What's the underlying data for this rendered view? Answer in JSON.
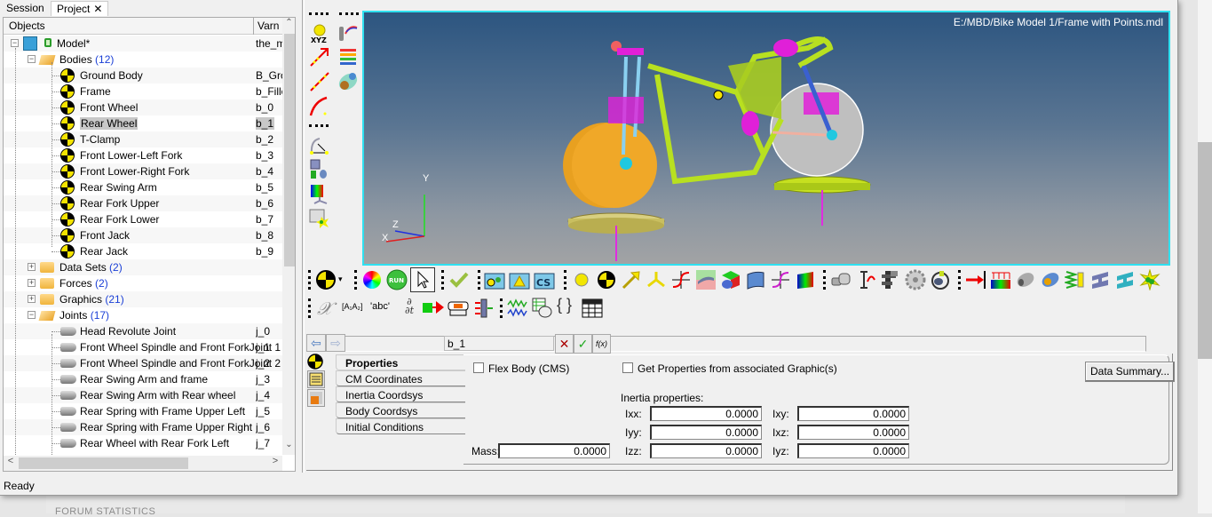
{
  "left_panel": {
    "tabs": [
      {
        "label": "Session"
      },
      {
        "label": "Project",
        "close": "✕",
        "active": true
      }
    ],
    "columns": {
      "objects": "Objects",
      "varname": "Varn"
    },
    "tree": [
      {
        "label": "Model*",
        "var": "the_m",
        "icon": "model-icon",
        "level": 0,
        "expanded": true
      },
      {
        "label": "Bodies",
        "count": "(12)",
        "icon": "folder-open-icon",
        "level": 1,
        "expanded": true
      },
      {
        "label": "Ground Body",
        "var": "B_Gro",
        "icon": "body-icon",
        "level": 2
      },
      {
        "label": "Frame",
        "var": "b_Fille",
        "icon": "body-icon",
        "level": 2
      },
      {
        "label": "Front Wheel",
        "var": "b_0",
        "icon": "body-icon",
        "level": 2
      },
      {
        "label": "Rear Wheel",
        "var": "b_1",
        "icon": "body-icon",
        "level": 2,
        "selected": true
      },
      {
        "label": "T-Clamp",
        "var": "b_2",
        "icon": "body-icon",
        "level": 2
      },
      {
        "label": "Front Lower-Left Fork",
        "var": "b_3",
        "icon": "body-icon",
        "level": 2
      },
      {
        "label": "Front Lower-Right Fork",
        "var": "b_4",
        "icon": "body-icon",
        "level": 2
      },
      {
        "label": "Rear Swing Arm",
        "var": "b_5",
        "icon": "body-icon",
        "level": 2
      },
      {
        "label": "Rear Fork Upper",
        "var": "b_6",
        "icon": "body-icon",
        "level": 2
      },
      {
        "label": "Rear Fork Lower",
        "var": "b_7",
        "icon": "body-icon",
        "level": 2
      },
      {
        "label": "Front Jack",
        "var": "b_8",
        "icon": "body-icon",
        "level": 2
      },
      {
        "label": "Rear Jack",
        "var": "b_9",
        "icon": "body-icon",
        "level": 2
      },
      {
        "label": "Data Sets",
        "count": "(2)",
        "icon": "folder-icon",
        "level": 1,
        "expanded": false
      },
      {
        "label": "Forces",
        "count": "(2)",
        "icon": "folder-icon",
        "level": 1,
        "expanded": false
      },
      {
        "label": "Graphics",
        "count": "(21)",
        "icon": "folder-icon",
        "level": 1,
        "expanded": false
      },
      {
        "label": "Joints",
        "count": "(17)",
        "icon": "folder-open-icon",
        "level": 1,
        "expanded": true
      },
      {
        "label": "Head Revolute Joint",
        "var": "j_0",
        "icon": "joint-icon",
        "level": 2
      },
      {
        "label": "Front Wheel Spindle and Front ForkJoint 1",
        "var": "j_1",
        "icon": "joint-icon",
        "level": 2
      },
      {
        "label": "Front Wheel Spindle and Front ForkJoint 2",
        "var": "j_2",
        "icon": "joint-icon",
        "level": 2
      },
      {
        "label": "Rear Swing Arm and frame",
        "var": "j_3",
        "icon": "joint-icon",
        "level": 2
      },
      {
        "label": "Rear Swing Arm with Rear wheel",
        "var": "j_4",
        "icon": "joint-icon",
        "level": 2
      },
      {
        "label": "Rear Spring with Frame Upper Left",
        "var": "j_5",
        "icon": "joint-icon",
        "level": 2
      },
      {
        "label": "Rear Spring with Frame Upper Right",
        "var": "j_6",
        "icon": "joint-icon",
        "level": 2
      },
      {
        "label": "Rear Wheel with Rear Fork Left",
        "var": "j_7",
        "icon": "joint-icon",
        "level": 2
      }
    ]
  },
  "status_bar": {
    "text": "Ready"
  },
  "viewport": {
    "file_path": "E:/MBD/Bike Model 1/Frame with Points.mdl",
    "triad": {
      "x": "X",
      "y": "Y",
      "z": "Z"
    }
  },
  "left_toolbar": {
    "items": [
      "point-xyz-icon",
      "tire-icon",
      "vector-icon",
      "spring-damper-icon",
      "line-icon",
      "belt-pulley-icon",
      "curve-icon",
      "angle-icon",
      "graphics-group-icon",
      "contour-icon",
      "entity-editor-icon"
    ],
    "point_caption": "XYZ"
  },
  "main_toolbar": {
    "row1": [
      "body-icon",
      "color-wheel-icon",
      "run-icon",
      "select-arrow-icon",
      "check-icon",
      "assembly-wizard-icon",
      "attachment-icon",
      "cs-icon",
      "point-icon",
      "body-icon-2",
      "vector-arrow-icon",
      "marker-icon",
      "curve-icon",
      "surface-icon",
      "graphic-icon",
      "deformable-surface-icon",
      "deformable-curve-icon",
      "contour-icon",
      "joint-icon",
      "motion-icon",
      "coupler-icon",
      "gear-icon",
      "actuator-icon",
      "force-icon",
      "field-icon",
      "bushing-icon",
      "flex-body-icon",
      "spring-damper-icon",
      "beam-icon",
      "polybeam-icon",
      "contact-icon"
    ],
    "run_label": "RUN",
    "cs_label": "CS",
    "row2": [
      "solver-variable-icon",
      "solver-array-icon",
      "solver-string-icon",
      "differential-equation-icon",
      "control-siso-icon",
      "state-equation-icon",
      "control-mimo-icon",
      "signal-icon",
      "templex-icon",
      "braces-icon",
      "table-icon"
    ],
    "string_label": "'abc'",
    "array_label": "[A₁A₂]"
  },
  "editor": {
    "nav": {
      "back": "back-arrow-icon",
      "forward": "forward-arrow-icon"
    },
    "name_value": "b_1",
    "buttons": {
      "cancel": "✕",
      "apply": "✓",
      "expression": "f(x)"
    },
    "tabs": [
      {
        "label": "Properties",
        "active": true
      },
      {
        "label": "CM Coordinates"
      },
      {
        "label": "Inertia Coordsys"
      },
      {
        "label": "Body Coordsys"
      },
      {
        "label": "Initial Conditions"
      }
    ],
    "flex_body": {
      "label": "Flex Body (CMS)",
      "checked": false
    },
    "get_props": {
      "label": "Get Properties from associated Graphic(s)",
      "checked": false
    },
    "data_summary": "Data Summary...",
    "inertia_title": "Inertia properties:",
    "mass": {
      "label": "Mass:",
      "value": "0.0000"
    },
    "inertia": [
      {
        "label": "Ixx:",
        "value": "0.0000"
      },
      {
        "label": "Ixy:",
        "value": "0.0000"
      },
      {
        "label": "Iyy:",
        "value": "0.0000"
      },
      {
        "label": "Ixz:",
        "value": "0.0000"
      },
      {
        "label": "Izz:",
        "value": "0.0000"
      },
      {
        "label": "Iyz:",
        "value": "0.0000"
      }
    ]
  },
  "background": {
    "forum_text": "FORUM STATISTICS"
  }
}
